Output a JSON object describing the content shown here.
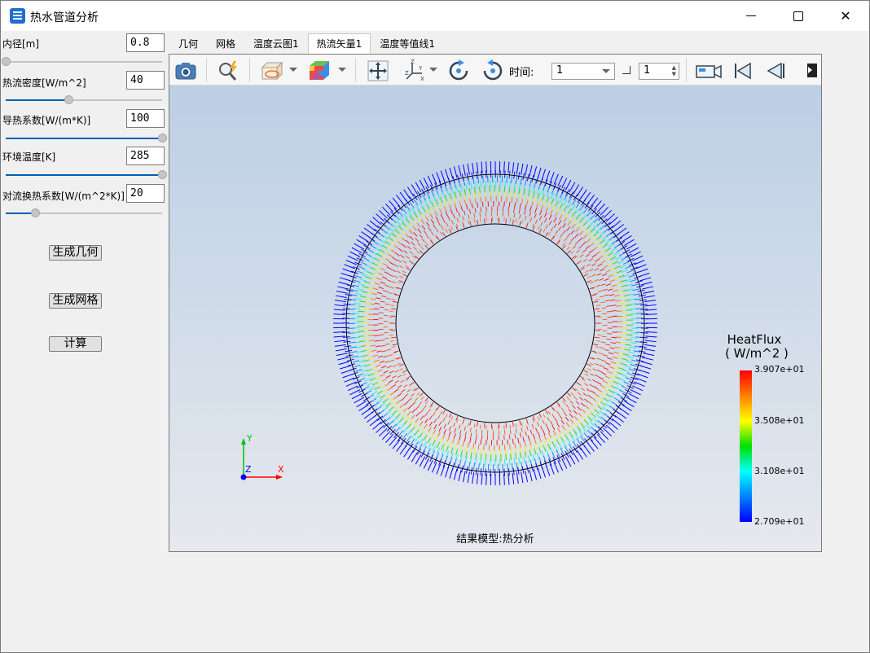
{
  "window": {
    "title": "热水管道分析"
  },
  "params": [
    {
      "label": "内径[m]",
      "value": "0.8",
      "slider": 0.0
    },
    {
      "label": "热流密度[W/m^2]",
      "value": "40",
      "slider": 0.4
    },
    {
      "label": "导热系数[W/(m*K)]",
      "value": "100",
      "slider": 1.0
    },
    {
      "label": "环境温度[K]",
      "value": "285",
      "slider": 1.0
    },
    {
      "label": "对流换热系数[W/(m^2*K)]",
      "value": "20",
      "slider": 0.19
    }
  ],
  "buttons": {
    "geometry": "生成几何",
    "mesh": "生成网格",
    "compute": "计算"
  },
  "tabs": [
    "几何",
    "网格",
    "温度云图1",
    "热流矢量1",
    "温度等值线1"
  ],
  "active_tab": 3,
  "toolbar": {
    "time_label": "时间:",
    "time_value": "1",
    "step_value": "1"
  },
  "legend": {
    "title": "HeatFlux",
    "unit": "( W/m^2 )",
    "ticks": [
      "3.907e+01",
      "3.508e+01",
      "3.108e+01",
      "2.709e+01"
    ]
  },
  "axes": {
    "y": "Y",
    "z": "Z",
    "x": "X"
  },
  "model_label": "结果模型:热分析",
  "colors": {
    "accent": "#005fb8",
    "arrow_outer": "#0000ff",
    "arrow_inner": "#ff0000"
  }
}
